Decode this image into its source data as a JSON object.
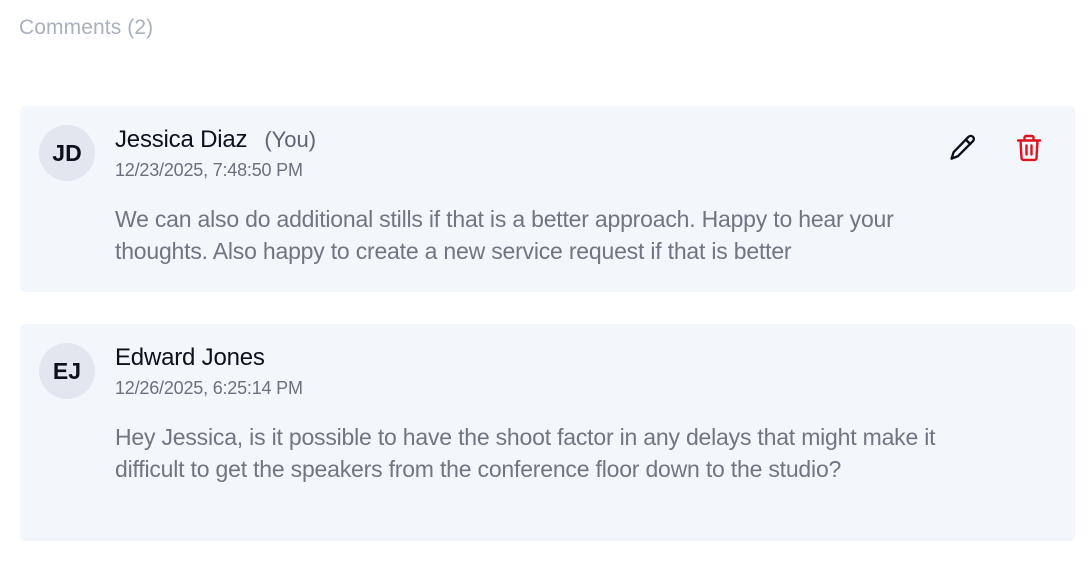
{
  "section": {
    "title": "Comments (2)"
  },
  "comments": [
    {
      "initials": "JD",
      "author": "Jessica Diaz",
      "you_tag": "(You)",
      "timestamp": "12/23/2025, 7:48:50 PM",
      "body": "We can also do additional stills if that is a better approach. Happy to hear your thoughts. Also happy to create a new service request if that is better",
      "actions": {
        "edit_icon": "pencil-icon",
        "delete_icon": "trash-icon"
      }
    },
    {
      "initials": "EJ",
      "author": "Edward Jones",
      "timestamp": "12/26/2025, 6:25:14 PM",
      "body": "Hey Jessica, is it possible to have the shoot factor in any delays that might make it difficult to get the speakers from the conference floor down to the studio?"
    }
  ],
  "colors": {
    "card_background": "#f3f6fa",
    "avatar_background": "#e2e7ef",
    "delete_red": "#e0141e",
    "edit_dark": "#0c0f1c"
  }
}
